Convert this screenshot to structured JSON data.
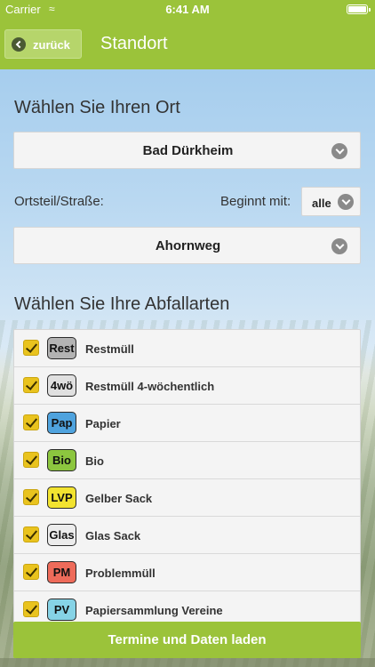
{
  "status_bar": {
    "carrier": "Carrier",
    "time": "6:41 AM"
  },
  "nav": {
    "back_label": "zurück",
    "title": "Standort"
  },
  "location": {
    "heading": "Wählen Sie Ihren Ort",
    "selected_town": "Bad Dürkheim",
    "street_label": "Ortsteil/Straße:",
    "starts_with_label": "Beginnt mit:",
    "starts_with_value": "alle",
    "selected_street": "Ahornweg"
  },
  "waste": {
    "heading": "Wählen Sie Ihre Abfallarten",
    "items": [
      {
        "badge": "Rest",
        "label": "Restmüll",
        "color": "#b3b3b3",
        "checked": true
      },
      {
        "badge": "4wö",
        "label": "Restmüll 4-wöchentlich",
        "color": "#e0e0e0",
        "checked": true
      },
      {
        "badge": "Pap",
        "label": "Papier",
        "color": "#4fa3de",
        "checked": true
      },
      {
        "badge": "Bio",
        "label": "Bio",
        "color": "#8cc63f",
        "checked": true
      },
      {
        "badge": "LVP",
        "label": "Gelber Sack",
        "color": "#f2e330",
        "checked": true
      },
      {
        "badge": "Glas",
        "label": "Glas Sack",
        "color": "#ececec",
        "checked": true
      },
      {
        "badge": "PM",
        "label": "Problemmüll",
        "color": "#ee6b5a",
        "checked": true
      },
      {
        "badge": "PV",
        "label": "Papiersammlung Vereine",
        "color": "#86d3e6",
        "checked": true
      }
    ]
  },
  "actions": {
    "load_label": "Termine und Daten laden"
  },
  "colors": {
    "accent": "#9bc33a",
    "checkbox": "#e9c31e"
  }
}
